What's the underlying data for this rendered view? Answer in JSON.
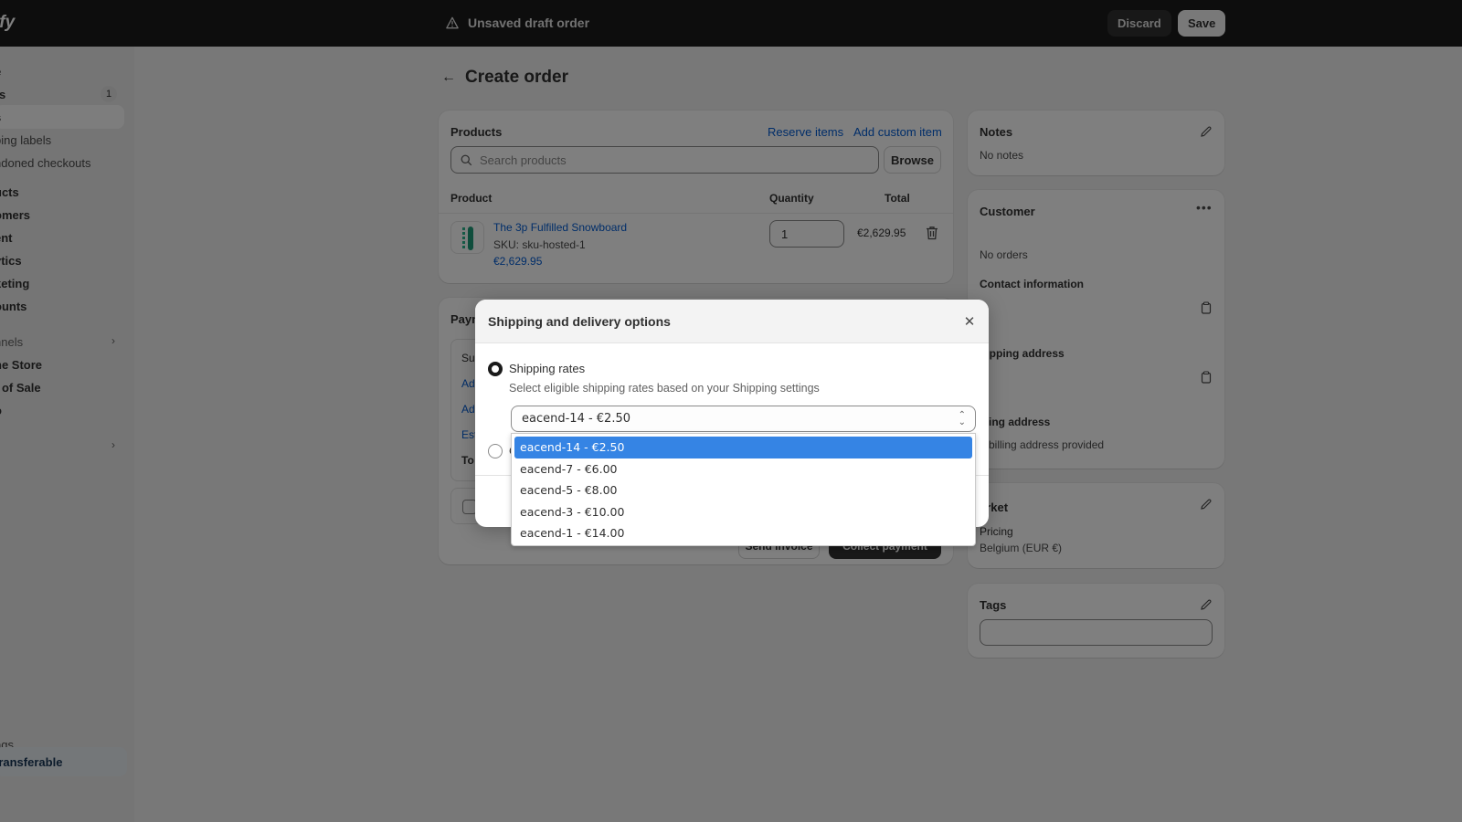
{
  "topbar": {
    "logo": "ify",
    "draft_status": "Unsaved draft order",
    "discard_label": "Discard",
    "save_label": "Save"
  },
  "sidebar": {
    "items": [
      {
        "label": "e",
        "type": "main"
      },
      {
        "label": "rs",
        "type": "main",
        "badge": "1"
      },
      {
        "label": "s",
        "type": "main",
        "active": true
      },
      {
        "label": "bing labels",
        "type": "sub"
      },
      {
        "label": "ndoned checkouts",
        "type": "sub"
      },
      {
        "label": "ucts",
        "type": "main"
      },
      {
        "label": "omers",
        "type": "main"
      },
      {
        "label": "ent",
        "type": "main"
      },
      {
        "label": "ytics",
        "type": "main"
      },
      {
        "label": "keting",
        "type": "main"
      },
      {
        "label": "ounts",
        "type": "main"
      },
      {
        "label": "nnels",
        "type": "section"
      },
      {
        "label": "ne Store",
        "type": "main"
      },
      {
        "label": "t of Sale",
        "type": "main"
      },
      {
        "label": "o",
        "type": "main"
      },
      {
        "label": "",
        "type": "section"
      },
      {
        "label": "ngs",
        "type": "main"
      }
    ],
    "transfer_label": "transferable"
  },
  "page": {
    "title": "Create order"
  },
  "products": {
    "title": "Products",
    "reserve_label": "Reserve items",
    "add_custom_label": "Add custom item",
    "search_placeholder": "Search products",
    "browse_label": "Browse",
    "columns": [
      "Product",
      "Quantity",
      "Total"
    ],
    "rows": [
      {
        "name": "The 3p Fulfilled Snowboard",
        "sku": "SKU: sku-hosted-1",
        "price": "€2,629.95",
        "quantity": "1",
        "total": "€2,629.95"
      }
    ]
  },
  "payment": {
    "title": "Payn",
    "lines": [
      "Su",
      "Ad",
      "Ad",
      "Est",
      "To"
    ],
    "send_invoice_label": "Send invoice",
    "collect_label": "Collect payment"
  },
  "notes": {
    "title": "Notes",
    "value": "No notes"
  },
  "customer": {
    "title": "Customer",
    "orders": "No orders",
    "contact_title": "Contact information",
    "shipping_title": "hipping address",
    "billing_title": "illing address",
    "billing_value": "o billing address provided"
  },
  "market": {
    "title": "arket",
    "pricing_label": "Pricing",
    "pricing_value": "Belgium (EUR €)"
  },
  "tags": {
    "title": "Tags",
    "value": ""
  },
  "modal": {
    "title": "Shipping and delivery options",
    "option1_label": "Shipping rates",
    "option1_help": "Select eligible shipping rates based on your Shipping settings",
    "selected_rate": "eacend-14 - €2.50",
    "option2_label": "C",
    "rates": [
      {
        "label": "eacend-14 - €2.50",
        "selected": true
      },
      {
        "label": "eacend-7 - €6.00",
        "selected": false
      },
      {
        "label": "eacend-5 - €8.00",
        "selected": false
      },
      {
        "label": "eacend-3 - €10.00",
        "selected": false
      },
      {
        "label": "eacend-1 - €14.00",
        "selected": false
      }
    ]
  },
  "colors": {
    "accent_link": "#005bd3",
    "selected_option": "#3584e4",
    "topbar": "#1a1a1a"
  }
}
